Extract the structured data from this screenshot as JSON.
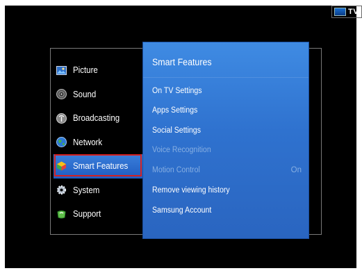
{
  "source": {
    "label": "TV",
    "icon": "tv-icon"
  },
  "menu": {
    "items": [
      {
        "label": "Picture",
        "icon": "picture-icon"
      },
      {
        "label": "Sound",
        "icon": "speaker-icon"
      },
      {
        "label": "Broadcasting",
        "icon": "antenna-icon"
      },
      {
        "label": "Network",
        "icon": "globe-icon"
      },
      {
        "label": "Smart Features",
        "icon": "smart-features-icon",
        "selected": true
      },
      {
        "label": "System",
        "icon": "gear-icon"
      },
      {
        "label": "Support",
        "icon": "support-icon"
      }
    ]
  },
  "submenu": {
    "title": "Smart Features",
    "items": [
      {
        "label": "On TV Settings",
        "enabled": true
      },
      {
        "label": "Apps Settings",
        "enabled": true
      },
      {
        "label": "Social Settings",
        "enabled": true
      },
      {
        "label": "Voice Recognition",
        "enabled": false
      },
      {
        "label": "Motion Control",
        "enabled": false,
        "value": "On"
      },
      {
        "label": "Remove viewing history",
        "enabled": true
      },
      {
        "label": "Samsung Account",
        "enabled": true
      }
    ]
  },
  "colors": {
    "panel_blue": "#2f72cf",
    "highlight_red": "#d42020",
    "disabled_text": "#86aee2"
  }
}
